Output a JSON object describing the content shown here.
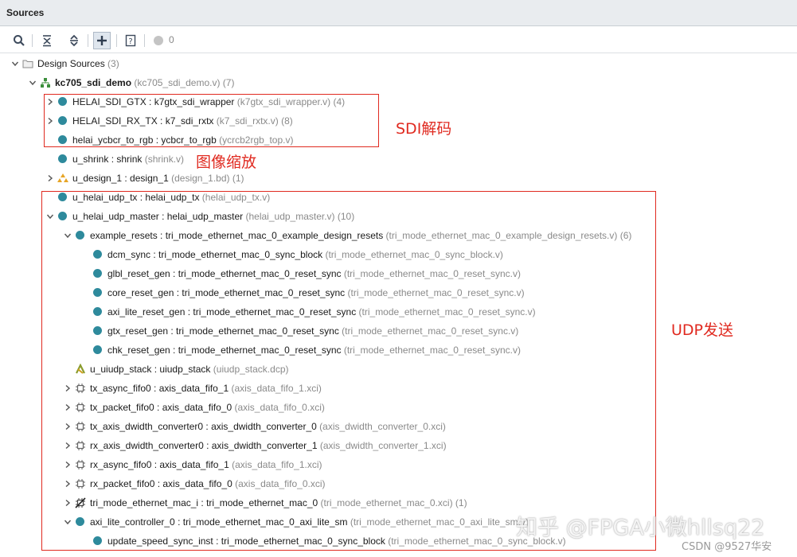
{
  "panel": {
    "title": "Sources"
  },
  "toolbar": {
    "search": "search",
    "collapse_all": "collapse-all",
    "expand_all": "expand-all",
    "add": "add-sources",
    "info": "source-file-properties",
    "status_count": "0"
  },
  "tree": {
    "rows": [
      {
        "name": "Design Sources",
        "rest": " (3)",
        "icon": "folder-icon",
        "chev": "down"
      },
      {
        "name": "kc705_sdi_demo",
        "rest": " (kc705_sdi_demo.v) (7)",
        "icon": "hierarchy-top-icon",
        "chev": "down",
        "bold": true
      },
      {
        "name": "HELAI_SDI_GTX : k7gtx_sdi_wrapper",
        "rest": " (k7gtx_sdi_wrapper.v) (4)",
        "icon": "verilog-module-icon",
        "chev": "right"
      },
      {
        "name": "HELAI_SDI_RX_TX : k7_sdi_rxtx",
        "rest": " (k7_sdi_rxtx.v) (8)",
        "icon": "verilog-module-icon",
        "chev": "right"
      },
      {
        "name": "helai_ycbcr_to_rgb : ycbcr_to_rgb",
        "rest": " (ycrcb2rgb_top.v)",
        "icon": "verilog-module-icon",
        "chev": ""
      },
      {
        "name": "u_shrink : shrink",
        "rest": " (shrink.v)",
        "icon": "verilog-module-icon",
        "chev": ""
      },
      {
        "name": "u_design_1 : design_1",
        "rest": " (design_1.bd) (1)",
        "icon": "block-design-icon",
        "chev": "right"
      },
      {
        "name": "u_helai_udp_tx : helai_udp_tx",
        "rest": " (helai_udp_tx.v)",
        "icon": "verilog-module-icon",
        "chev": ""
      },
      {
        "name": "u_helai_udp_master : helai_udp_master",
        "rest": " (helai_udp_master.v) (10)",
        "icon": "verilog-module-icon",
        "chev": "down"
      },
      {
        "name": "example_resets : tri_mode_ethernet_mac_0_example_design_resets",
        "rest": " (tri_mode_ethernet_mac_0_example_design_resets.v) (6)",
        "icon": "verilog-module-icon",
        "chev": "down"
      },
      {
        "name": "dcm_sync : tri_mode_ethernet_mac_0_sync_block",
        "rest": " (tri_mode_ethernet_mac_0_sync_block.v)",
        "icon": "verilog-module-icon",
        "chev": ""
      },
      {
        "name": "glbl_reset_gen : tri_mode_ethernet_mac_0_reset_sync",
        "rest": " (tri_mode_ethernet_mac_0_reset_sync.v)",
        "icon": "verilog-module-icon",
        "chev": ""
      },
      {
        "name": "core_reset_gen : tri_mode_ethernet_mac_0_reset_sync",
        "rest": " (tri_mode_ethernet_mac_0_reset_sync.v)",
        "icon": "verilog-module-icon",
        "chev": ""
      },
      {
        "name": "axi_lite_reset_gen : tri_mode_ethernet_mac_0_reset_sync",
        "rest": " (tri_mode_ethernet_mac_0_reset_sync.v)",
        "icon": "verilog-module-icon",
        "chev": ""
      },
      {
        "name": "gtx_reset_gen : tri_mode_ethernet_mac_0_reset_sync",
        "rest": " (tri_mode_ethernet_mac_0_reset_sync.v)",
        "icon": "verilog-module-icon",
        "chev": ""
      },
      {
        "name": "chk_reset_gen : tri_mode_ethernet_mac_0_reset_sync",
        "rest": " (tri_mode_ethernet_mac_0_reset_sync.v)",
        "icon": "verilog-module-icon",
        "chev": ""
      },
      {
        "name": "u_uiudp_stack : uiudp_stack",
        "rest": " (uiudp_stack.dcp)",
        "icon": "dcp-icon",
        "chev": ""
      },
      {
        "name": "tx_async_fifo0 : axis_data_fifo_1",
        "rest": " (axis_data_fifo_1.xci)",
        "icon": "ip-core-icon",
        "chev": "right"
      },
      {
        "name": "tx_packet_fifo0 : axis_data_fifo_0",
        "rest": " (axis_data_fifo_0.xci)",
        "icon": "ip-core-icon",
        "chev": "right"
      },
      {
        "name": "tx_axis_dwidth_converter0 : axis_dwidth_converter_0",
        "rest": " (axis_dwidth_converter_0.xci)",
        "icon": "ip-core-icon",
        "chev": "right"
      },
      {
        "name": "rx_axis_dwidth_converter0 : axis_dwidth_converter_1",
        "rest": " (axis_dwidth_converter_1.xci)",
        "icon": "ip-core-icon",
        "chev": "right"
      },
      {
        "name": "rx_async_fifo0 : axis_data_fifo_1",
        "rest": " (axis_data_fifo_1.xci)",
        "icon": "ip-core-icon",
        "chev": "right"
      },
      {
        "name": "rx_packet_fifo0 : axis_data_fifo_0",
        "rest": " (axis_data_fifo_0.xci)",
        "icon": "ip-core-icon",
        "chev": "right"
      },
      {
        "name": "tri_mode_ethernet_mac_i : tri_mode_ethernet_mac_0",
        "rest": " (tri_mode_ethernet_mac_0.xci) (1)",
        "icon": "ip-core-locked-icon",
        "chev": "right"
      },
      {
        "name": "axi_lite_controller_0 : tri_mode_ethernet_mac_0_axi_lite_sm",
        "rest": " (tri_mode_ethernet_mac_0_axi_lite_sm.v)",
        "icon": "verilog-module-icon",
        "chev": "down"
      },
      {
        "name": "update_speed_sync_inst : tri_mode_ethernet_mac_0_sync_block",
        "rest": " (tri_mode_ethernet_mac_0_sync_block.v)",
        "icon": "verilog-module-icon",
        "chev": ""
      }
    ]
  },
  "annotations": {
    "sdi": "SDI解码",
    "scale": "图像缩放",
    "udp": "UDP发送"
  },
  "watermark": {
    "zhihu": "知乎 @FPGA小微hllsq22",
    "csdn": "CSDN @9527华安"
  },
  "colors": {
    "module_dot": "#2e8a9c",
    "annotation_red": "#e02a20",
    "secondary_text": "#8a8a8a"
  }
}
